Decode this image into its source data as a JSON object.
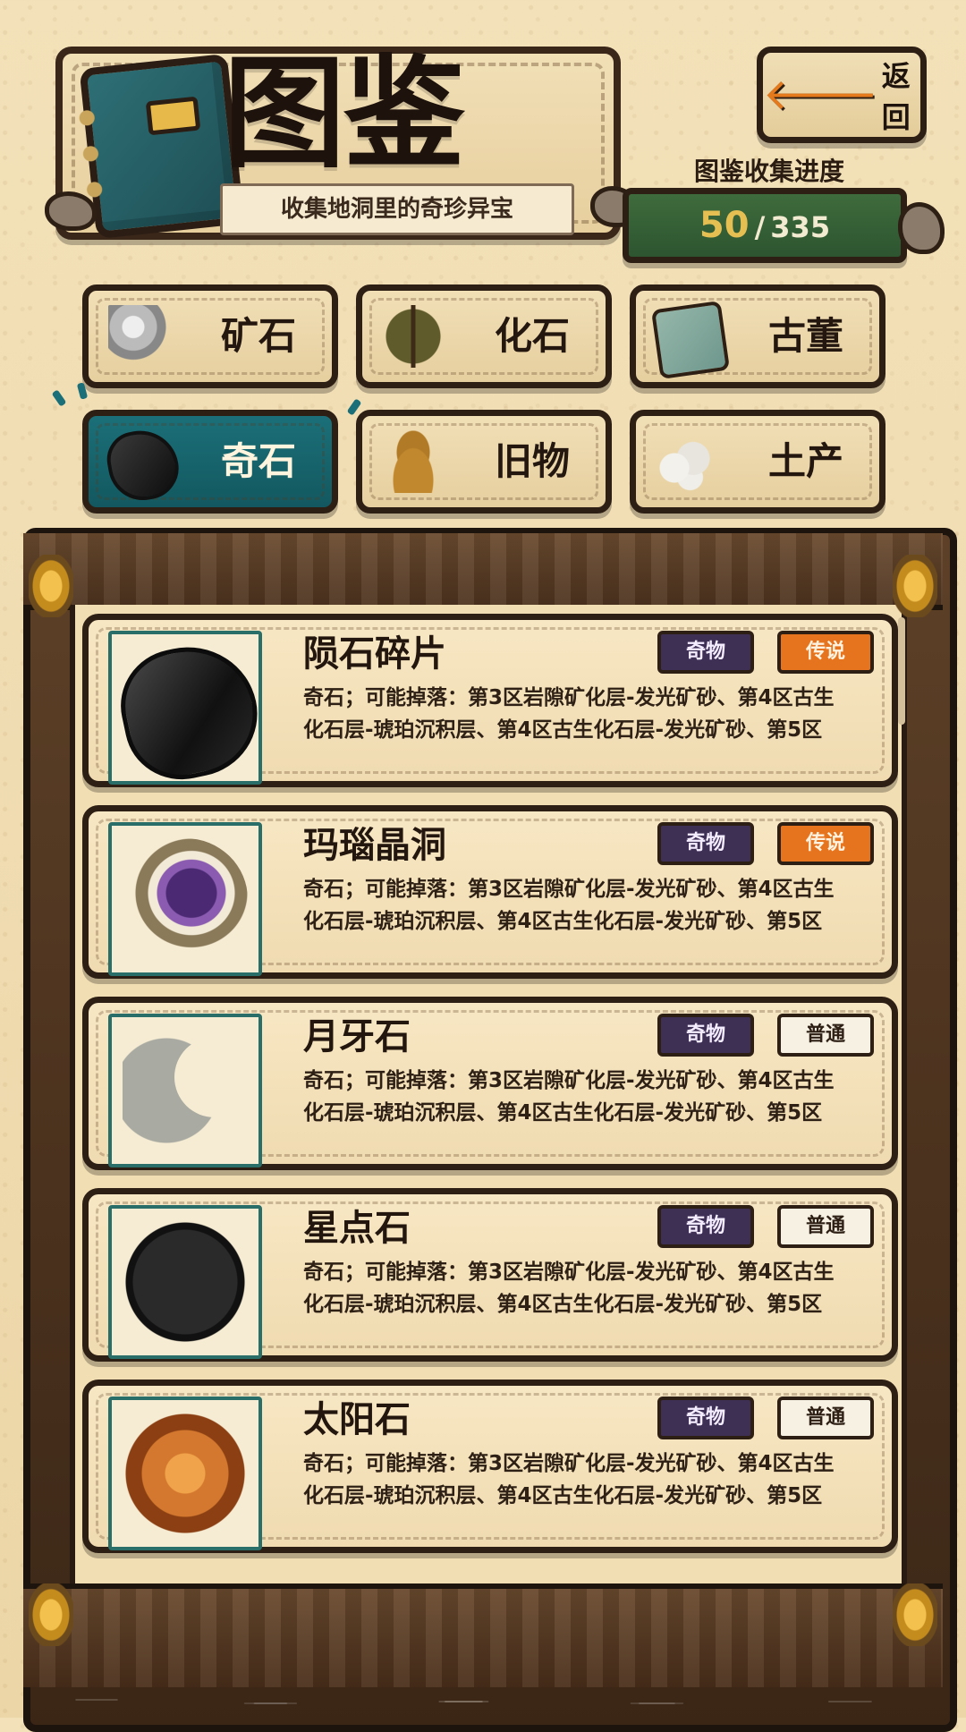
{
  "header": {
    "title": "图鉴",
    "subtitle": "收集地洞里的奇珍异宝",
    "back_label": "返回",
    "back_icon": "arrow-left-icon",
    "book_icon": "book-icon"
  },
  "progress": {
    "label": "图鉴收集进度",
    "current": "50",
    "separator": "/",
    "total": "335",
    "colors": {
      "bar": "#2d5530",
      "current": "#e5bf52"
    }
  },
  "tabs": [
    {
      "label": "矿石",
      "icon": "ore-icon",
      "active": false
    },
    {
      "label": "化石",
      "icon": "fern-fossil-icon",
      "active": false
    },
    {
      "label": "古董",
      "icon": "jade-tablet-icon",
      "active": false
    },
    {
      "label": "奇石",
      "icon": "black-rock-icon",
      "active": true
    },
    {
      "label": "旧物",
      "icon": "bell-icon",
      "active": false
    },
    {
      "label": "土产",
      "icon": "crystal-cluster-icon",
      "active": false
    }
  ],
  "items": [
    {
      "name": "陨石碎片",
      "kind": "奇物",
      "rarity": "传说",
      "desc1": "奇石；可能掉落：第3区岩隙矿化层-发光矿砂、第4区古生",
      "desc2": "化石层-琥珀沉积层、第4区古生化石层-发光矿砂、第5区",
      "icon": "meteorite-icon"
    },
    {
      "name": "玛瑙晶洞",
      "kind": "奇物",
      "rarity": "传说",
      "desc1": "奇石；可能掉落：第3区岩隙矿化层-发光矿砂、第4区古生",
      "desc2": "化石层-琥珀沉积层、第4区古生化石层-发光矿砂、第5区",
      "icon": "geode-icon"
    },
    {
      "name": "月牙石",
      "kind": "奇物",
      "rarity": "普通",
      "desc1": "奇石；可能掉落：第3区岩隙矿化层-发光矿砂、第4区古生",
      "desc2": "化石层-琥珀沉积层、第4区古生化石层-发光矿砂、第5区",
      "icon": "crescent-stone-icon"
    },
    {
      "name": "星点石",
      "kind": "奇物",
      "rarity": "普通",
      "desc1": "奇石；可能掉落：第3区岩隙矿化层-发光矿砂、第4区古生",
      "desc2": "化石层-琥珀沉积层、第4区古生化石层-发光矿砂、第5区",
      "icon": "star-stone-icon"
    },
    {
      "name": "太阳石",
      "kind": "奇物",
      "rarity": "普通",
      "desc1": "奇石；可能掉落：第3区岩隙矿化层-发光矿砂、第4区古生",
      "desc2": "化石层-琥珀沉积层、第4区古生化石层-发光矿砂、第5区",
      "icon": "sun-stone-icon"
    }
  ],
  "colors": {
    "tab_active": "#1b6f78",
    "legend_badge": "#e6741f",
    "kind_badge": "#3e2f55",
    "background": "#f1ddb2"
  }
}
